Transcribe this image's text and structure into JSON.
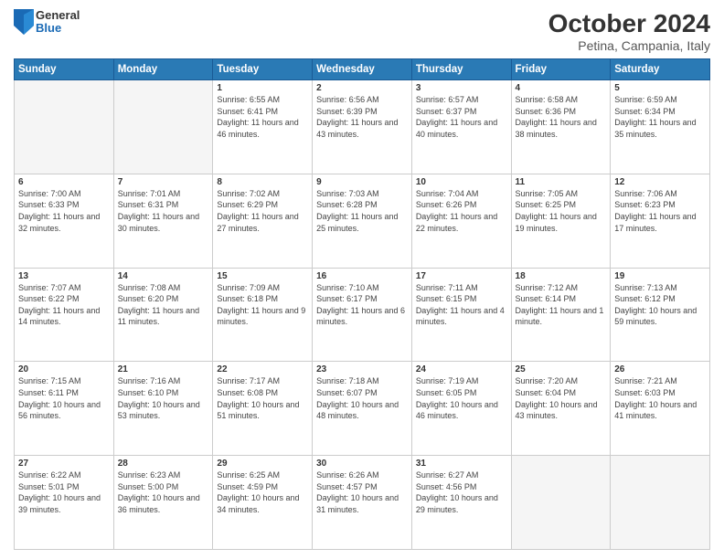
{
  "logo": {
    "general": "General",
    "blue": "Blue"
  },
  "title": "October 2024",
  "subtitle": "Petina, Campania, Italy",
  "days_of_week": [
    "Sunday",
    "Monday",
    "Tuesday",
    "Wednesday",
    "Thursday",
    "Friday",
    "Saturday"
  ],
  "weeks": [
    [
      {
        "num": "",
        "empty": true
      },
      {
        "num": "",
        "empty": true
      },
      {
        "num": "1",
        "sunrise": "6:55 AM",
        "sunset": "6:41 PM",
        "daylight": "11 hours and 46 minutes."
      },
      {
        "num": "2",
        "sunrise": "6:56 AM",
        "sunset": "6:39 PM",
        "daylight": "11 hours and 43 minutes."
      },
      {
        "num": "3",
        "sunrise": "6:57 AM",
        "sunset": "6:37 PM",
        "daylight": "11 hours and 40 minutes."
      },
      {
        "num": "4",
        "sunrise": "6:58 AM",
        "sunset": "6:36 PM",
        "daylight": "11 hours and 38 minutes."
      },
      {
        "num": "5",
        "sunrise": "6:59 AM",
        "sunset": "6:34 PM",
        "daylight": "11 hours and 35 minutes."
      }
    ],
    [
      {
        "num": "6",
        "sunrise": "7:00 AM",
        "sunset": "6:33 PM",
        "daylight": "11 hours and 32 minutes."
      },
      {
        "num": "7",
        "sunrise": "7:01 AM",
        "sunset": "6:31 PM",
        "daylight": "11 hours and 30 minutes."
      },
      {
        "num": "8",
        "sunrise": "7:02 AM",
        "sunset": "6:29 PM",
        "daylight": "11 hours and 27 minutes."
      },
      {
        "num": "9",
        "sunrise": "7:03 AM",
        "sunset": "6:28 PM",
        "daylight": "11 hours and 25 minutes."
      },
      {
        "num": "10",
        "sunrise": "7:04 AM",
        "sunset": "6:26 PM",
        "daylight": "11 hours and 22 minutes."
      },
      {
        "num": "11",
        "sunrise": "7:05 AM",
        "sunset": "6:25 PM",
        "daylight": "11 hours and 19 minutes."
      },
      {
        "num": "12",
        "sunrise": "7:06 AM",
        "sunset": "6:23 PM",
        "daylight": "11 hours and 17 minutes."
      }
    ],
    [
      {
        "num": "13",
        "sunrise": "7:07 AM",
        "sunset": "6:22 PM",
        "daylight": "11 hours and 14 minutes."
      },
      {
        "num": "14",
        "sunrise": "7:08 AM",
        "sunset": "6:20 PM",
        "daylight": "11 hours and 11 minutes."
      },
      {
        "num": "15",
        "sunrise": "7:09 AM",
        "sunset": "6:18 PM",
        "daylight": "11 hours and 9 minutes."
      },
      {
        "num": "16",
        "sunrise": "7:10 AM",
        "sunset": "6:17 PM",
        "daylight": "11 hours and 6 minutes."
      },
      {
        "num": "17",
        "sunrise": "7:11 AM",
        "sunset": "6:15 PM",
        "daylight": "11 hours and 4 minutes."
      },
      {
        "num": "18",
        "sunrise": "7:12 AM",
        "sunset": "6:14 PM",
        "daylight": "11 hours and 1 minute."
      },
      {
        "num": "19",
        "sunrise": "7:13 AM",
        "sunset": "6:12 PM",
        "daylight": "10 hours and 59 minutes."
      }
    ],
    [
      {
        "num": "20",
        "sunrise": "7:15 AM",
        "sunset": "6:11 PM",
        "daylight": "10 hours and 56 minutes."
      },
      {
        "num": "21",
        "sunrise": "7:16 AM",
        "sunset": "6:10 PM",
        "daylight": "10 hours and 53 minutes."
      },
      {
        "num": "22",
        "sunrise": "7:17 AM",
        "sunset": "6:08 PM",
        "daylight": "10 hours and 51 minutes."
      },
      {
        "num": "23",
        "sunrise": "7:18 AM",
        "sunset": "6:07 PM",
        "daylight": "10 hours and 48 minutes."
      },
      {
        "num": "24",
        "sunrise": "7:19 AM",
        "sunset": "6:05 PM",
        "daylight": "10 hours and 46 minutes."
      },
      {
        "num": "25",
        "sunrise": "7:20 AM",
        "sunset": "6:04 PM",
        "daylight": "10 hours and 43 minutes."
      },
      {
        "num": "26",
        "sunrise": "7:21 AM",
        "sunset": "6:03 PM",
        "daylight": "10 hours and 41 minutes."
      }
    ],
    [
      {
        "num": "27",
        "sunrise": "6:22 AM",
        "sunset": "5:01 PM",
        "daylight": "10 hours and 39 minutes."
      },
      {
        "num": "28",
        "sunrise": "6:23 AM",
        "sunset": "5:00 PM",
        "daylight": "10 hours and 36 minutes."
      },
      {
        "num": "29",
        "sunrise": "6:25 AM",
        "sunset": "4:59 PM",
        "daylight": "10 hours and 34 minutes."
      },
      {
        "num": "30",
        "sunrise": "6:26 AM",
        "sunset": "4:57 PM",
        "daylight": "10 hours and 31 minutes."
      },
      {
        "num": "31",
        "sunrise": "6:27 AM",
        "sunset": "4:56 PM",
        "daylight": "10 hours and 29 minutes."
      },
      {
        "num": "",
        "empty": true
      },
      {
        "num": "",
        "empty": true
      }
    ]
  ]
}
